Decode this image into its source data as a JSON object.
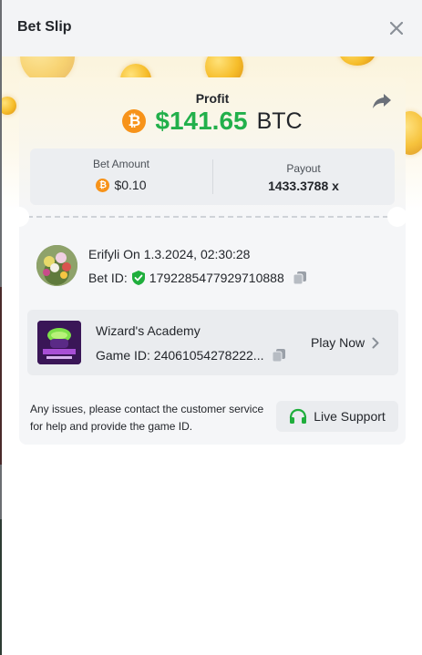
{
  "header": {
    "title": "Bet Slip"
  },
  "profit": {
    "label": "Profit",
    "amount": "$141.65",
    "currency": "BTC"
  },
  "bet": {
    "amount_label": "Bet Amount",
    "amount": "$0.10",
    "payout_label": "Payout",
    "payout": "1433.3788 x"
  },
  "user": {
    "name": "Erifyli",
    "date": "On 1.3.2024, 02:30:28",
    "bet_id_label": "Bet ID:",
    "bet_id": "1792285477929710888"
  },
  "game": {
    "title": "Wizard's Academy",
    "id_label": "Game ID:",
    "id": "24061054278222...",
    "play_label": "Play Now"
  },
  "support": {
    "note": "Any issues, please contact the customer service for help and provide the game ID.",
    "button_label": "Live Support"
  },
  "colors": {
    "profit_green": "#22b04b",
    "btc_orange": "#f7931a",
    "shield_green": "#1fae3c",
    "support_green": "#1fae3c"
  },
  "icons": {
    "close": "close-icon",
    "share": "share-icon",
    "btc": "bitcoin-icon",
    "shield": "verified-shield-icon",
    "copy": "copy-icon",
    "chevron": "chevron-right-icon",
    "headset": "headset-icon"
  }
}
